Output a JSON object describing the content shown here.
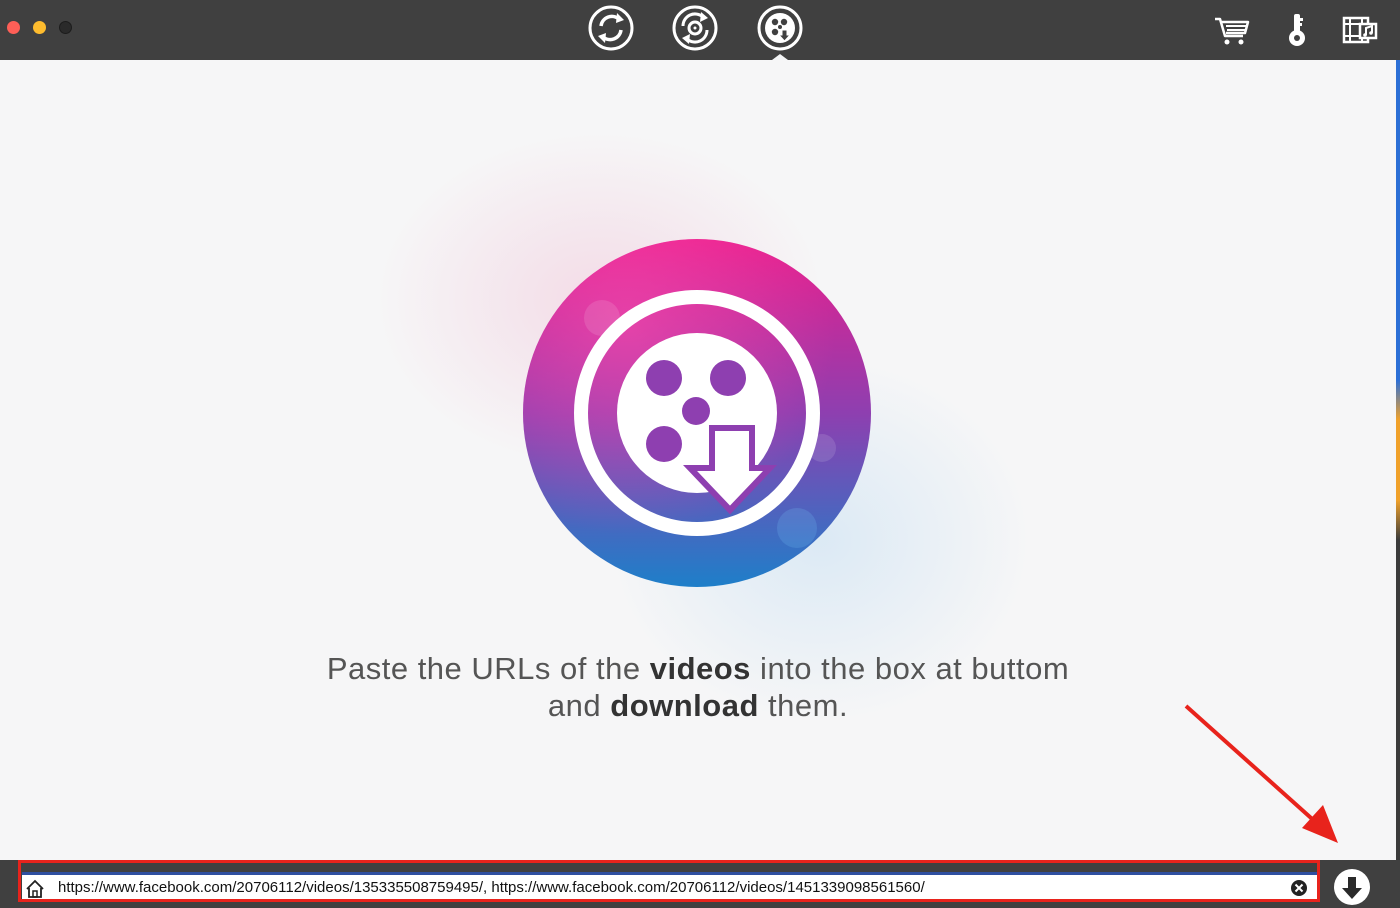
{
  "window": {
    "traffic_lights": [
      "close",
      "minimize",
      "zoom"
    ]
  },
  "toolbar": {
    "modes": [
      {
        "icon": "convert-icon",
        "active": false
      },
      {
        "icon": "burn-icon",
        "active": false
      },
      {
        "icon": "download-icon",
        "active": true
      }
    ],
    "right_icons": [
      "cart-icon",
      "key-icon",
      "media-browser-icon"
    ]
  },
  "main": {
    "logo_icon": "video-download-logo",
    "headline": {
      "part1": "Paste the URLs of the ",
      "bold1": "videos",
      "part2": " into the box at buttom",
      "part3": "and ",
      "bold2": "download",
      "part4": " them."
    }
  },
  "url_bar": {
    "value": "https://www.facebook.com/20706112/videos/135335508759495/, https://www.facebook.com/20706112/videos/1451339098561560/",
    "home_icon": "home-icon",
    "clear_icon": "clear-icon",
    "download_icon": "download-arrow-icon"
  },
  "colors": {
    "toolbar_bg": "#404040",
    "annotation_red": "#e8231c",
    "logo_pink": "#e91e8c",
    "logo_purple": "#8e3fb0",
    "logo_blue": "#1e7fc9"
  }
}
